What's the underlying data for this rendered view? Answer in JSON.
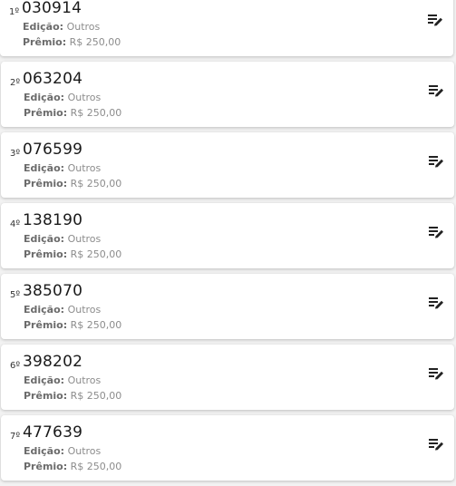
{
  "list": {
    "edition_label": "Edição:",
    "prize_label": "Prêmio:",
    "action_icon": "edit-note-icon",
    "items": [
      {
        "position": "1º",
        "number": "030914",
        "edition": "Outros",
        "prize": "R$ 250,00"
      },
      {
        "position": "2º",
        "number": "063204",
        "edition": "Outros",
        "prize": "R$ 250,00"
      },
      {
        "position": "3º",
        "number": "076599",
        "edition": "Outros",
        "prize": "R$ 250,00"
      },
      {
        "position": "4º",
        "number": "138190",
        "edition": "Outros",
        "prize": "R$ 250,00"
      },
      {
        "position": "5º",
        "number": "385070",
        "edition": "Outros",
        "prize": "R$ 250,00"
      },
      {
        "position": "6º",
        "number": "398202",
        "edition": "Outros",
        "prize": "R$ 250,00"
      },
      {
        "position": "7º",
        "number": "477639",
        "edition": "Outros",
        "prize": "R$ 250,00"
      }
    ]
  }
}
